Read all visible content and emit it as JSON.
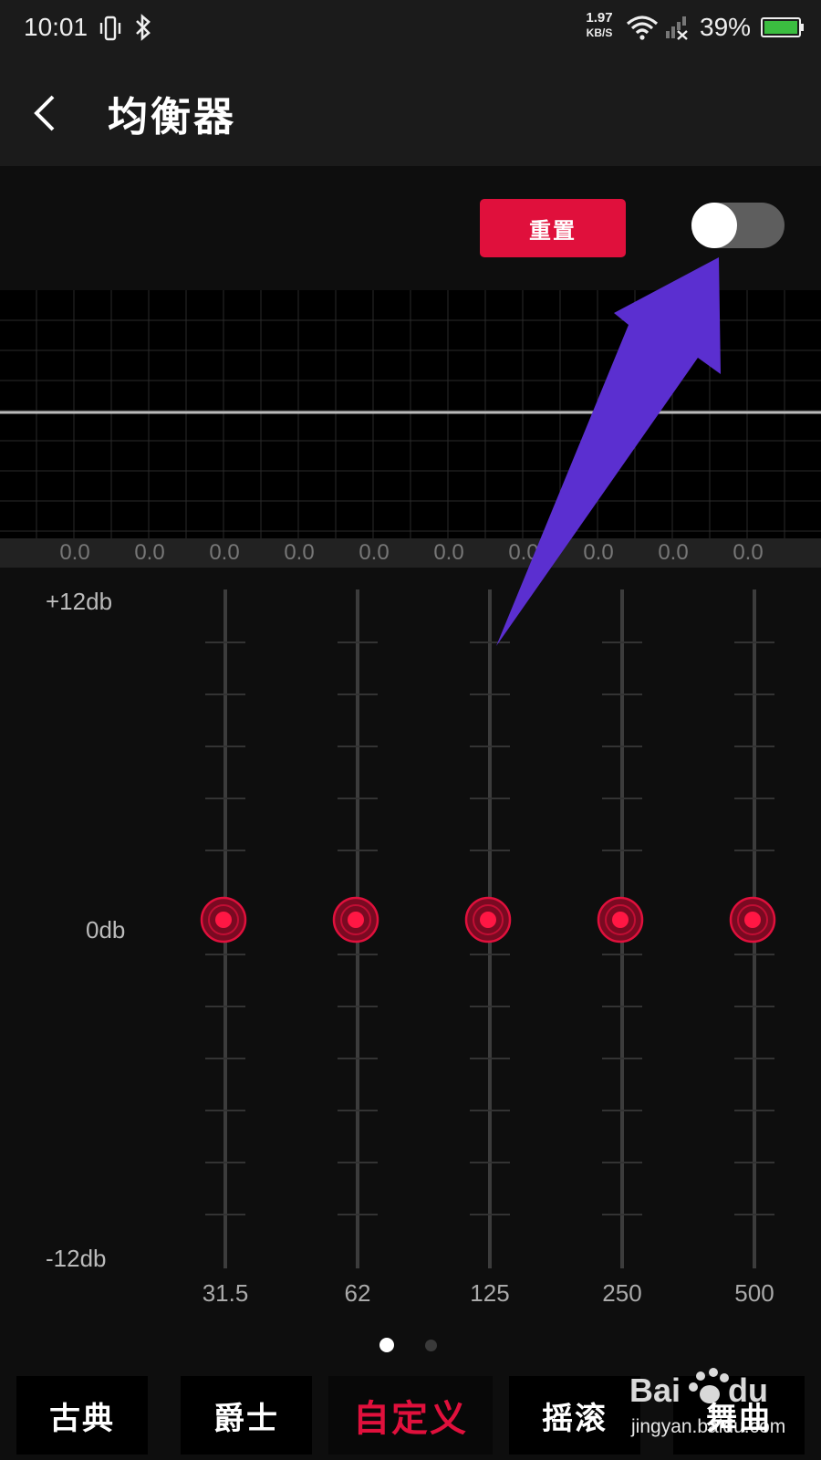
{
  "status_bar": {
    "time": "10:01",
    "speed_value": "1.97",
    "speed_unit": "KB/S",
    "battery": "39%",
    "icons": [
      "vibrate-icon",
      "bluetooth-icon",
      "wifi-icon",
      "signal-icon",
      "battery-icon"
    ]
  },
  "header": {
    "title": "均衡器",
    "back_icon": "chevron-left-icon"
  },
  "controls": {
    "reset_label": "重置",
    "toggle_state": "off"
  },
  "band_values": [
    "0.0",
    "0.0",
    "0.0",
    "0.0",
    "0.0",
    "0.0",
    "0.0",
    "0.0",
    "0.0",
    "0.0"
  ],
  "eq": {
    "max_label": "+12db",
    "mid_label": "0db",
    "min_label": "-12db",
    "bands": [
      {
        "freq": "31.5",
        "gain": 0
      },
      {
        "freq": "62",
        "gain": 0
      },
      {
        "freq": "125",
        "gain": 0
      },
      {
        "freq": "250",
        "gain": 0
      },
      {
        "freq": "500",
        "gain": 0
      }
    ]
  },
  "pager": {
    "pages": 2,
    "active": 0
  },
  "presets": [
    "古典",
    "爵士",
    "自定义",
    "摇滚",
    "舞曲"
  ],
  "active_preset": "自定义",
  "colors": {
    "accent": "#e0103c",
    "background": "#0e0e0e",
    "header": "#1b1b1b",
    "annotation_arrow": "#5b2fd0"
  },
  "watermark": {
    "logo": "Bai du",
    "url": "jingyan.baidu.com"
  }
}
